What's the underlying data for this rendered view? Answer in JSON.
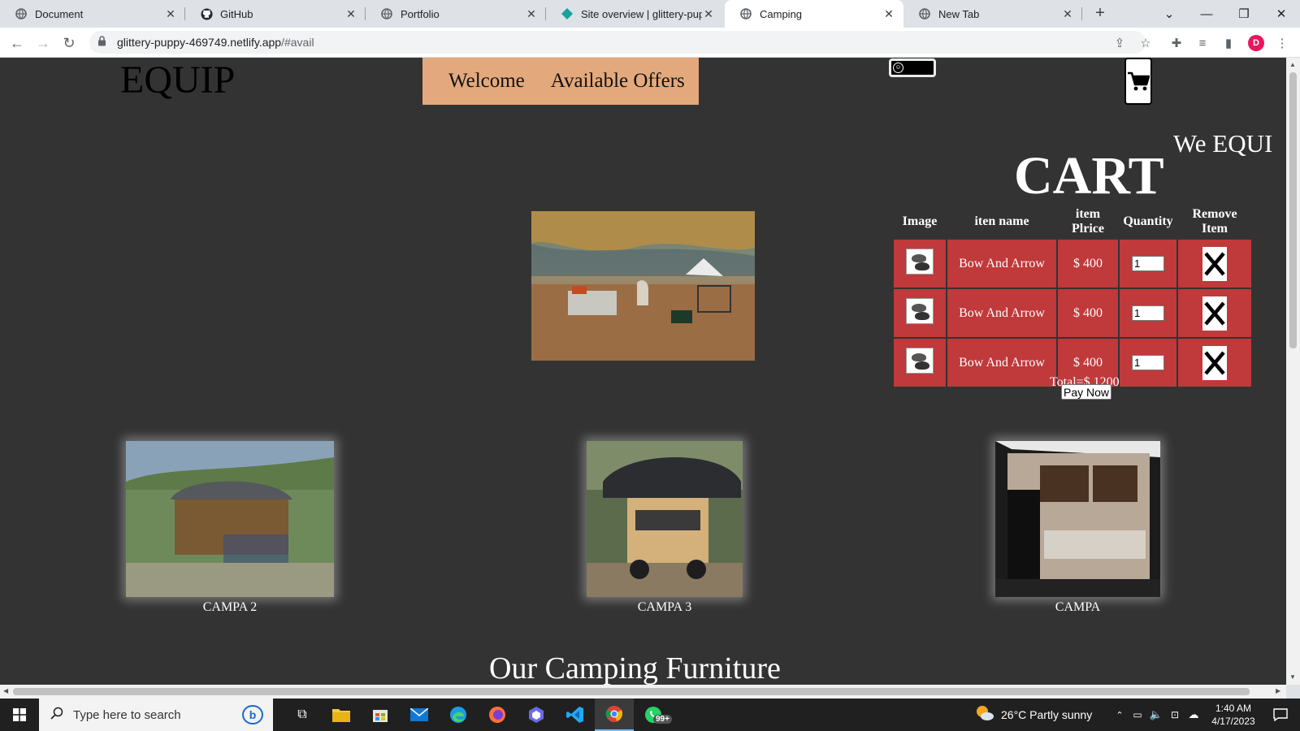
{
  "browser": {
    "tabs": [
      {
        "title": "Document",
        "active": false
      },
      {
        "title": "GitHub",
        "active": false
      },
      {
        "title": "Portfolio",
        "active": false
      },
      {
        "title": "Site overview | glittery-puppy",
        "active": false
      },
      {
        "title": "Camping",
        "active": true
      },
      {
        "title": "New Tab",
        "active": false
      }
    ],
    "url_host": "glittery-puppy-469749.netlify.app",
    "url_path": "/#avail",
    "profile_initial": "D"
  },
  "page": {
    "brand": "EQUIP",
    "nav": {
      "welcome": "Welcome",
      "offers": "Available Offers"
    },
    "marquee": "We EQUI",
    "cart": {
      "title": "CART",
      "headers": {
        "image": "Image",
        "name": "iten name",
        "price": "item Plrice",
        "qty": "Quantity",
        "remove": "Remove Item"
      },
      "rows": [
        {
          "name": "Bow And Arrow",
          "price": "$ 400",
          "qty": "1"
        },
        {
          "name": "Bow And Arrow",
          "price": "$ 400",
          "qty": "1"
        },
        {
          "name": "Bow And Arrow",
          "price": "$ 400",
          "qty": "1"
        }
      ],
      "total": "Total=$ 1200",
      "pay_label": "Pay Now"
    },
    "cards": [
      {
        "caption": "CAMPA 2"
      },
      {
        "caption": "CAMPA 3"
      },
      {
        "caption": "CAMPA"
      }
    ],
    "section_title": "Our Camping Furniture"
  },
  "taskbar": {
    "search_placeholder": "Type here to search",
    "weather": "26°C  Partly sunny",
    "time": "1:40 AM",
    "date": "4/17/2023",
    "badge": "99+"
  },
  "colors": {
    "page_bg": "#333333",
    "nav_bg": "#e3a97c",
    "cart_cell": "#c0393b"
  }
}
